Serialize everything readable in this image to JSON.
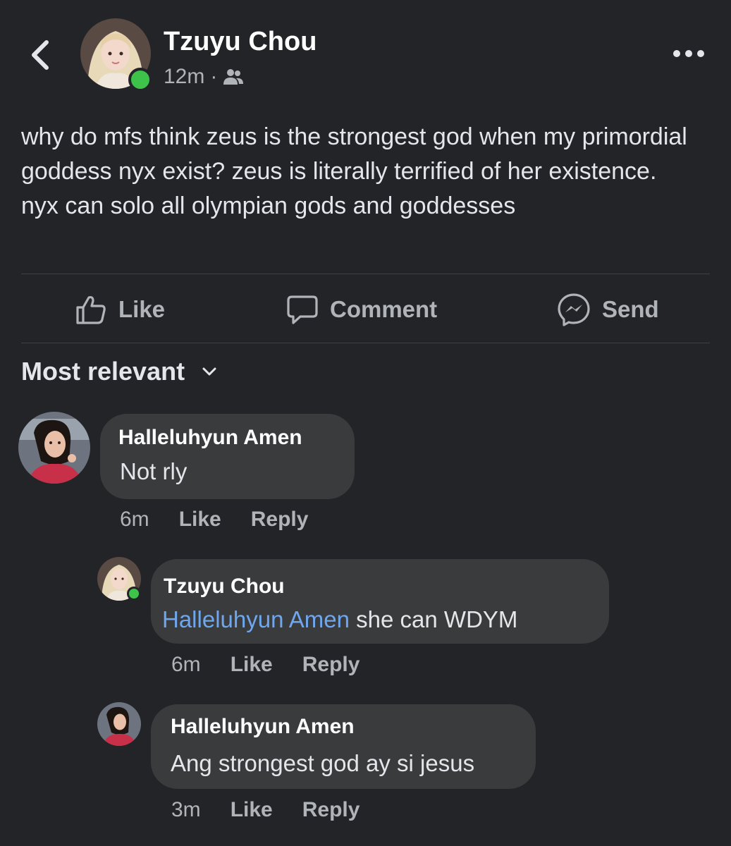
{
  "post": {
    "author": "Tzuyu Chou",
    "time": "12m",
    "separator": "·",
    "audience_icon": "friends-icon",
    "text": "why do mfs think zeus is the strongest god when my primordial goddess nyx exist? zeus is literally terrified of her existence. nyx can solo all olympian gods and goddesses"
  },
  "actions": {
    "like": "Like",
    "comment": "Comment",
    "send": "Send"
  },
  "sort": {
    "label": "Most relevant"
  },
  "comments": [
    {
      "author": "Halleluhyun Amen",
      "mention": "",
      "text": "Not rly",
      "time": "6m",
      "like": "Like",
      "reply": "Reply"
    },
    {
      "author": "Tzuyu Chou",
      "mention": "Halleluhyun Amen",
      "text": " she can WDYM",
      "time": "6m",
      "like": "Like",
      "reply": "Reply"
    },
    {
      "author": "Halleluhyun Amen",
      "mention": "",
      "text": "Ang strongest god ay si jesus",
      "time": "3m",
      "like": "Like",
      "reply": "Reply"
    }
  ],
  "colors": {
    "background": "#232427",
    "bubble": "#3a3b3c",
    "mention": "#6fa7ee",
    "online": "#3ec34a"
  }
}
